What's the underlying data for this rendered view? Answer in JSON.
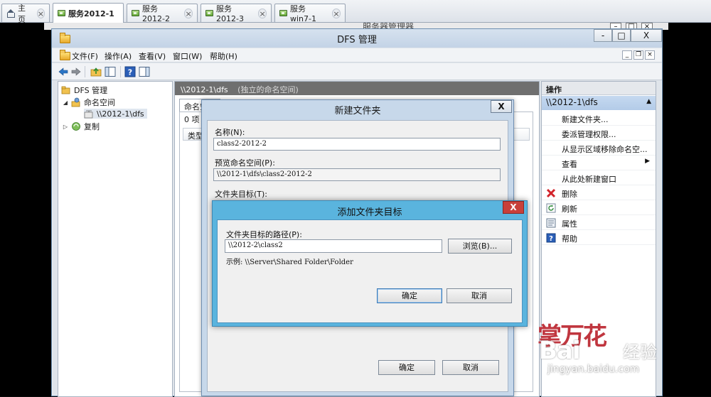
{
  "browser_tabs": [
    {
      "label": "主页",
      "icon": "home-icon",
      "active": false
    },
    {
      "label": "服务2012-1",
      "icon": "vm-icon",
      "active": true
    },
    {
      "label": "服务2012-2",
      "icon": "vm-icon",
      "active": false
    },
    {
      "label": "服务2012-3",
      "icon": "vm-icon",
      "active": false
    },
    {
      "label": "服务win7-1",
      "icon": "vm-icon",
      "active": false
    }
  ],
  "behind_window": {
    "title": "服务器管理器"
  },
  "window": {
    "title": "DFS 管理",
    "controls": {
      "minimize": "-",
      "maximize": "□",
      "close": "X"
    }
  },
  "menu": [
    "文件(F)",
    "操作(A)",
    "查看(V)",
    "窗口(W)",
    "帮助(H)"
  ],
  "tree": {
    "root": "DFS 管理",
    "namespaces": "命名空间",
    "namespace_item": "\\\\2012-1\\dfs",
    "replication": "复制"
  },
  "center": {
    "header_path": "\\\\2012-1\\dfs",
    "header_note": "(独立的命名空间)",
    "tab_label": "命名空间",
    "count": "0 项",
    "column": "类型"
  },
  "actions": {
    "title": "操作",
    "section": "\\\\2012-1\\dfs",
    "items": [
      {
        "label": "新建文件夹...",
        "icon": "none"
      },
      {
        "label": "委派管理权限...",
        "icon": "none"
      },
      {
        "label": "从显示区域移除命名空...",
        "icon": "none"
      },
      {
        "label": "查看",
        "icon": "none",
        "submenu": "▶"
      },
      {
        "label": "从此处新建窗口",
        "icon": "none"
      },
      {
        "label": "删除",
        "icon": "delete-icon"
      },
      {
        "label": "刷新",
        "icon": "refresh-icon"
      },
      {
        "label": "属性",
        "icon": "properties-icon"
      },
      {
        "label": "帮助",
        "icon": "help-icon"
      }
    ]
  },
  "new_folder_dialog": {
    "title": "新建文件夹",
    "close": "X",
    "name_label": "名称(N):",
    "name_value": "class2-2012-2",
    "preview_label": "预览命名空间(P):",
    "preview_value": "\\\\2012-1\\dfs\\class2-2012-2",
    "targets_label": "文件夹目标(T):",
    "ok": "确定",
    "cancel": "取消"
  },
  "add_target_dialog": {
    "title": "添加文件夹目标",
    "close": "X",
    "path_label": "文件夹目标的路径(P):",
    "path_value": "\\\\2012-2\\class2",
    "browse": "浏览(B)...",
    "example": "示例: \\\\Server\\Shared Folder\\Folder",
    "ok": "确定",
    "cancel": "取消"
  },
  "watermark": {
    "cn1": "掌万花",
    "logo": "Bai",
    "cn2": "经验",
    "url": "jingyan.baidu.com"
  },
  "colors": {
    "titlebar": "#c3d3e6",
    "dialog_active": "#5ab4de",
    "close_red": "#c8403a",
    "header_grey": "#6f6f6f"
  }
}
